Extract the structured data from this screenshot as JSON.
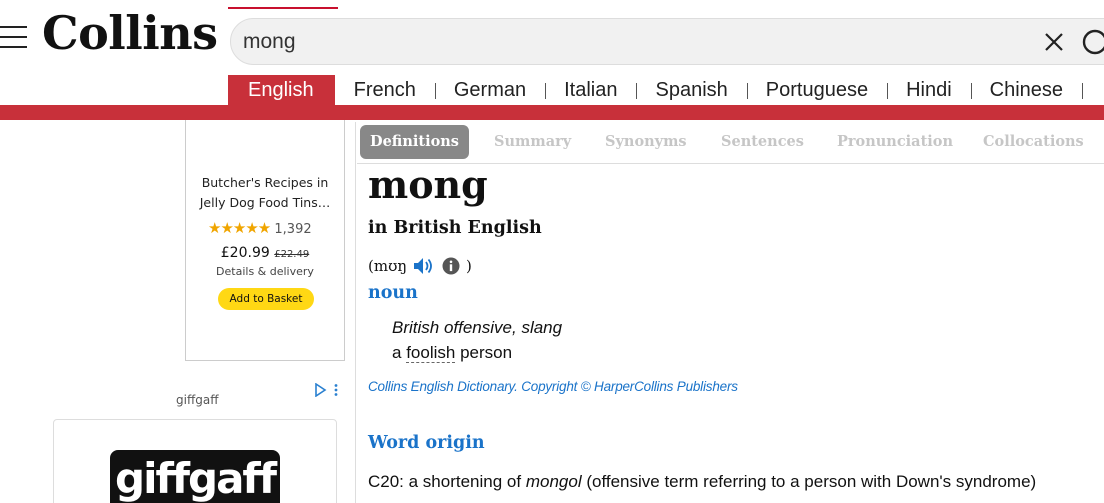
{
  "header": {
    "logo": "Collins",
    "search_value": "mong",
    "icons": {
      "menu": "hamburger-menu-icon",
      "clear": "close-x-icon",
      "search": "magnifier-search-icon"
    }
  },
  "languages": [
    "English",
    "French",
    "German",
    "Italian",
    "Spanish",
    "Portuguese",
    "Hindi",
    "Chinese"
  ],
  "active_language": "English",
  "colors": {
    "brand_red": "#c8303a",
    "link_blue": "#1a73c9",
    "ad_button_yellow": "#ffd814",
    "tab_active_gray": "#888888"
  },
  "ad1": {
    "title_line1": "Butcher's Recipes in",
    "title_line2": "Jelly Dog Food Tins…",
    "stars": "★★★★★",
    "rating": 4.5,
    "rating_count": "1,392",
    "price": "£20.99",
    "old_price": "£22.49",
    "delivery": "Details & delivery",
    "button": "Add to Basket"
  },
  "ad2": {
    "advertiser": "giffgaff",
    "logo_text": "giffgaff",
    "adchoices_icon": "ad-choices-icon"
  },
  "section_tabs": [
    "Definitions",
    "Summary",
    "Synonyms",
    "Sentences",
    "Pronunciation",
    "Collocations"
  ],
  "active_section": "Definitions",
  "entry": {
    "headword": "mong",
    "dictionary": "in British English",
    "pron_open": "(",
    "pron_ipa": "mʊŋ",
    "pron_close": ")",
    "part_of_speech": "noun",
    "usage_label": "British offensive, slang",
    "def_prefix": "a",
    "def_link": "foolish",
    "def_suffix": "person",
    "copyright": "Collins English Dictionary. Copyright © HarperCollins Publishers",
    "origin_heading": "Word origin",
    "origin_prefix": "C20: a shortening of",
    "origin_word": "mongol",
    "origin_suffix": "(offensive term referring to a person with Down's syndrome)"
  }
}
